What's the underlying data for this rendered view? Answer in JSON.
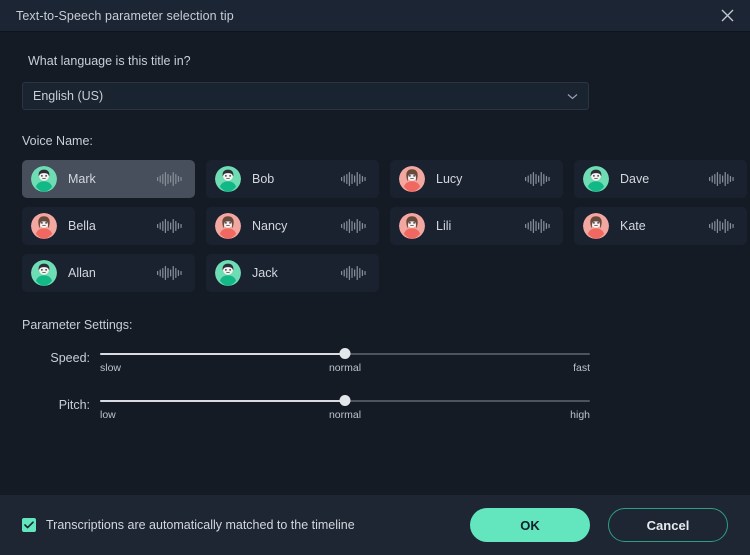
{
  "window": {
    "title": "Text-to-Speech parameter selection tip",
    "close_icon": "close-icon"
  },
  "language": {
    "question": "What language is this title in?",
    "selected": "English (US)",
    "chevron_icon": "chevron-down-icon"
  },
  "voices": {
    "label": "Voice Name:",
    "items": [
      {
        "name": "Mark",
        "gender": "male",
        "selected": true
      },
      {
        "name": "Bob",
        "gender": "male",
        "selected": false
      },
      {
        "name": "Lucy",
        "gender": "female",
        "selected": false
      },
      {
        "name": "Dave",
        "gender": "male",
        "selected": false
      },
      {
        "name": "Bella",
        "gender": "female",
        "selected": false
      },
      {
        "name": "Nancy",
        "gender": "female",
        "selected": false
      },
      {
        "name": "Lili",
        "gender": "female",
        "selected": false
      },
      {
        "name": "Kate",
        "gender": "female",
        "selected": false
      },
      {
        "name": "Allan",
        "gender": "male",
        "selected": false
      },
      {
        "name": "Jack",
        "gender": "male",
        "selected": false
      }
    ]
  },
  "parameters": {
    "label": "Parameter Settings:",
    "sliders": [
      {
        "label": "Speed:",
        "value_percent": 50,
        "ticks": {
          "start": "slow",
          "mid": "normal",
          "end": "fast"
        }
      },
      {
        "label": "Pitch:",
        "value_percent": 50,
        "ticks": {
          "start": "low",
          "mid": "normal",
          "end": "high"
        }
      }
    ]
  },
  "footer": {
    "checkbox_label": "Transcriptions are automatically matched to the timeline",
    "checkbox_checked": true,
    "ok_label": "OK",
    "cancel_label": "Cancel"
  },
  "colors": {
    "accent": "#63e6be",
    "avatar_male": "#6fdcb4",
    "avatar_female": "#f2a8a0",
    "dialog_bg": "#141b25",
    "card_bg": "#1a2230",
    "card_selected_bg": "#464f5b",
    "footer_bg": "#1d2632"
  }
}
